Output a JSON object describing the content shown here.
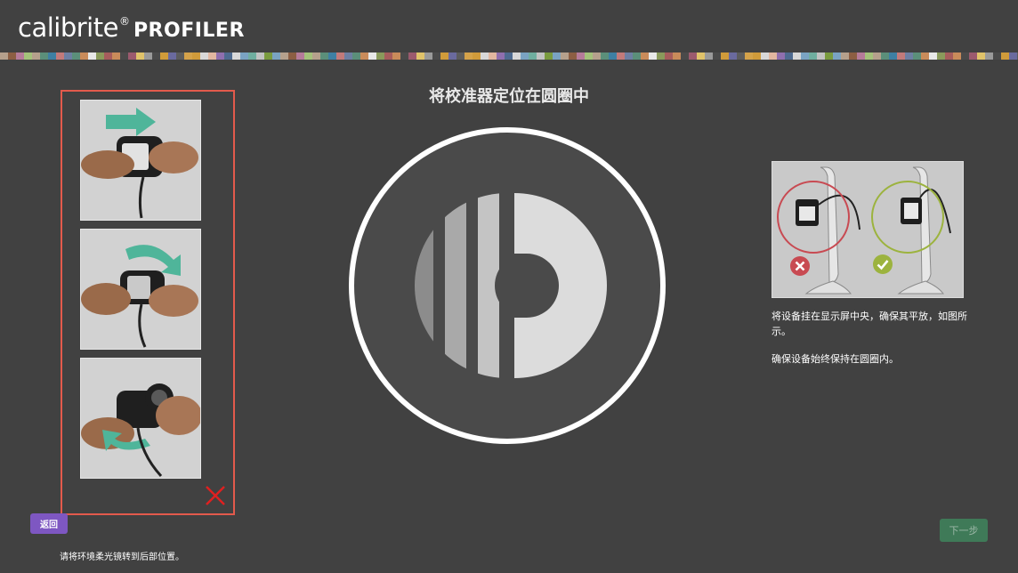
{
  "header": {
    "brand": "calibrite",
    "registered_mark": "®",
    "product": "PROFILER"
  },
  "swatch_colors": [
    "#b5a08c",
    "#6d7fa3",
    "#8a9a5b",
    "#9b5a6e",
    "#d09b3a",
    "#4e6a8f",
    "#c2c2c2",
    "#8c5e43",
    "#5b8f7a",
    "#a65c5c",
    "#e0c36a",
    "#6a6a9e",
    "#d8d8d8",
    "#7a9b3e",
    "#b57b9a",
    "#3e7fa3",
    "#c98b5a",
    "#9a9a9a",
    "#5c5c5c",
    "#e2b7a0",
    "#7aa3c2",
    "#a3c27a",
    "#c27a7a",
    "#e8e8e8",
    "#4a4a4a",
    "#d4a24a",
    "#8f6fae",
    "#6fae9f"
  ],
  "left_panel": {
    "close_icon": "close-x-icon"
  },
  "main": {
    "title": "将校准器定位在圆圈中"
  },
  "right_panel": {
    "instruction_1": "将设备挂在显示屏中央，确保其平放，如图所示。",
    "instruction_2": "确保设备始终保持在圆圈内。",
    "wrong_icon": "cross-circle-icon",
    "right_icon": "check-circle-icon",
    "wrong_color": "#c84a52",
    "right_color": "#9cb33e"
  },
  "footer": {
    "back_label": "返回",
    "hint": "请将环境柔光镜转到后部位置。",
    "next_label": "下一步"
  },
  "colors": {
    "background": "#414141",
    "panel_border": "#e35a4c",
    "back_button": "#7e57c2",
    "next_button": "#3f7a58"
  }
}
